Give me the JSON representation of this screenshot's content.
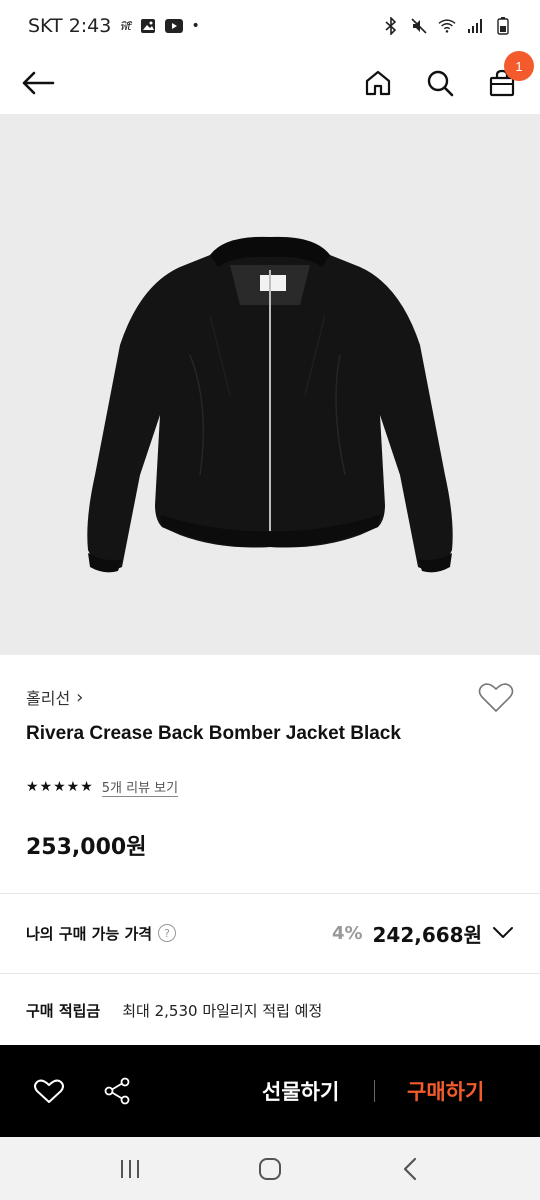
{
  "status": {
    "carrier_time": "SKT 2:43",
    "mini_app_label": "ฟิtิ",
    "dot": "•"
  },
  "nav": {
    "cart_count": "1",
    "icons": [
      "back-arrow-icon",
      "home-icon",
      "search-icon",
      "cart-icon"
    ]
  },
  "product": {
    "brand": "홀리선",
    "brand_chevron": "›",
    "name": "Rivera Crease Back Bomber Jacket Black",
    "stars": "★★★★★",
    "rating": 5,
    "review_link": "5개 리뷰 보기",
    "price": "253,000원"
  },
  "available_price": {
    "label": "나의 구매 가능 가격",
    "help_glyph": "?",
    "discount": "4%",
    "price": "242,668원"
  },
  "points": {
    "label": "구매 적립금",
    "text": "최대 2,530 마일리지 적립 예정"
  },
  "bottom_bar": {
    "gift_label": "선물하기",
    "buy_label": "구매하기",
    "accent_color": "#f45b2c"
  }
}
